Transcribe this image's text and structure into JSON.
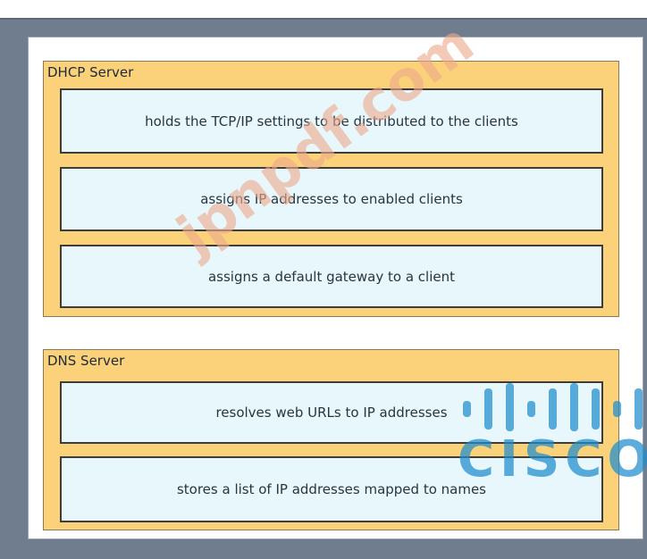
{
  "dhcp": {
    "title": "DHCP Server",
    "items": [
      "holds the TCP/IP settings to be distributed to the clients",
      "assigns IP addresses to enabled clients",
      "assigns a default gateway to a client"
    ]
  },
  "dns": {
    "title": "DNS Server",
    "items": [
      "resolves web URLs to IP addresses",
      "stores a list of IP addresses mapped to names"
    ]
  },
  "watermark": {
    "text": "jpnpdf.com"
  },
  "logo": {
    "text": "CISCO",
    "icon": "cisco-logo-icon"
  },
  "colors": {
    "background": "#6f7d8e",
    "group_fill": "#fbd27a",
    "item_fill": "#e7f7fb",
    "item_border": "#3d3d3d",
    "cisco_blue": "#1e8ccd"
  }
}
